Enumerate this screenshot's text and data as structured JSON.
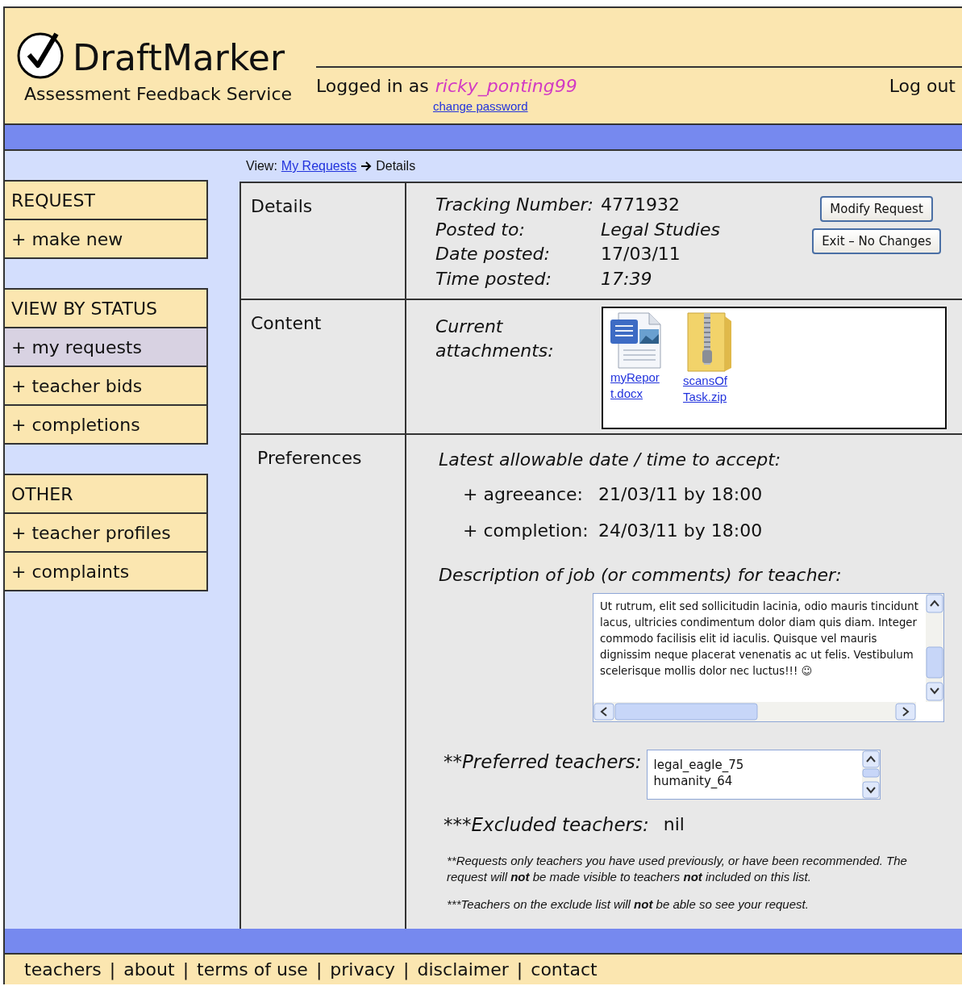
{
  "header": {
    "app_name": "DraftMarker",
    "tagline": "Assessment Feedback Service",
    "logged_in_label": "Logged in as",
    "username": "ricky_ponting99",
    "change_password": "change password",
    "logout": "Log out"
  },
  "breadcrumb": {
    "prefix": "View:",
    "link": "My Requests",
    "current": "Details"
  },
  "sidebar": [
    {
      "heading": "REQUEST",
      "items": [
        {
          "label": "+ make new",
          "selected": false
        }
      ]
    },
    {
      "heading": "VIEW BY STATUS",
      "items": [
        {
          "label": "+ my requests",
          "selected": true
        },
        {
          "label": "+ teacher bids",
          "selected": false
        },
        {
          "label": "+ completions",
          "selected": false
        }
      ]
    },
    {
      "heading": "OTHER",
      "items": [
        {
          "label": "+ teacher profiles",
          "selected": false
        },
        {
          "label": "+ complaints",
          "selected": false
        }
      ]
    }
  ],
  "details": {
    "label": "Details",
    "fields": [
      {
        "name": "Tracking Number:",
        "value": "4771932",
        "italic": false
      },
      {
        "name": "Posted to:",
        "value": "Legal Studies",
        "italic": true
      },
      {
        "name": "Date posted:",
        "value": "17/03/11",
        "italic": false
      },
      {
        "name": "Time posted:",
        "value": "17:39",
        "italic": true
      }
    ],
    "buttons": [
      "Modify Request",
      "Exit – No Changes"
    ]
  },
  "content": {
    "label": "Content",
    "attachments_label": "Current attachments:",
    "attachments": [
      {
        "kind": "document",
        "name": "myReport.docx"
      },
      {
        "kind": "archive",
        "name": "scansOfTask.zip"
      }
    ]
  },
  "preferences": {
    "label": "Preferences",
    "deadline_heading": "Latest allowable date / time to accept:",
    "deadlines": [
      {
        "name": "+ agreeance:",
        "value": "21/03/11 by 18:00"
      },
      {
        "name": "+ completion:",
        "value": "24/03/11 by 18:00"
      }
    ],
    "description_heading": "Description of job (or comments) for teacher:",
    "description": "Ut rutrum, elit sed sollicitudin lacinia, odio mauris tincidunt lacus, ultricies condimentum dolor diam quis diam. Integer commodo facilisis elit id iaculis. Quisque vel mauris dignissim neque placerat venenatis ac ut felis. Vestibulum scelerisque mollis dolor nec luctus!!! ☺",
    "preferred_label": "**Preferred teachers:",
    "preferred": [
      "legal_eagle_75",
      "humanity_64"
    ],
    "excluded_label": "***Excluded teachers:",
    "excluded": "nil",
    "notes": [
      {
        "marker": "**",
        "text": "Requests only teachers you have used previously, or have been recommended. The request will **not** be made visible to teachers **not** included on this list."
      },
      {
        "marker": "***",
        "text": "Teachers on the exclude list will **not** be able so see your request."
      }
    ]
  },
  "footer": {
    "links": [
      "teachers",
      "about",
      "terms of use",
      "privacy",
      "disclaimer",
      "contact"
    ],
    "separators": [
      "|",
      "|",
      "|",
      "|",
      "|"
    ]
  }
}
